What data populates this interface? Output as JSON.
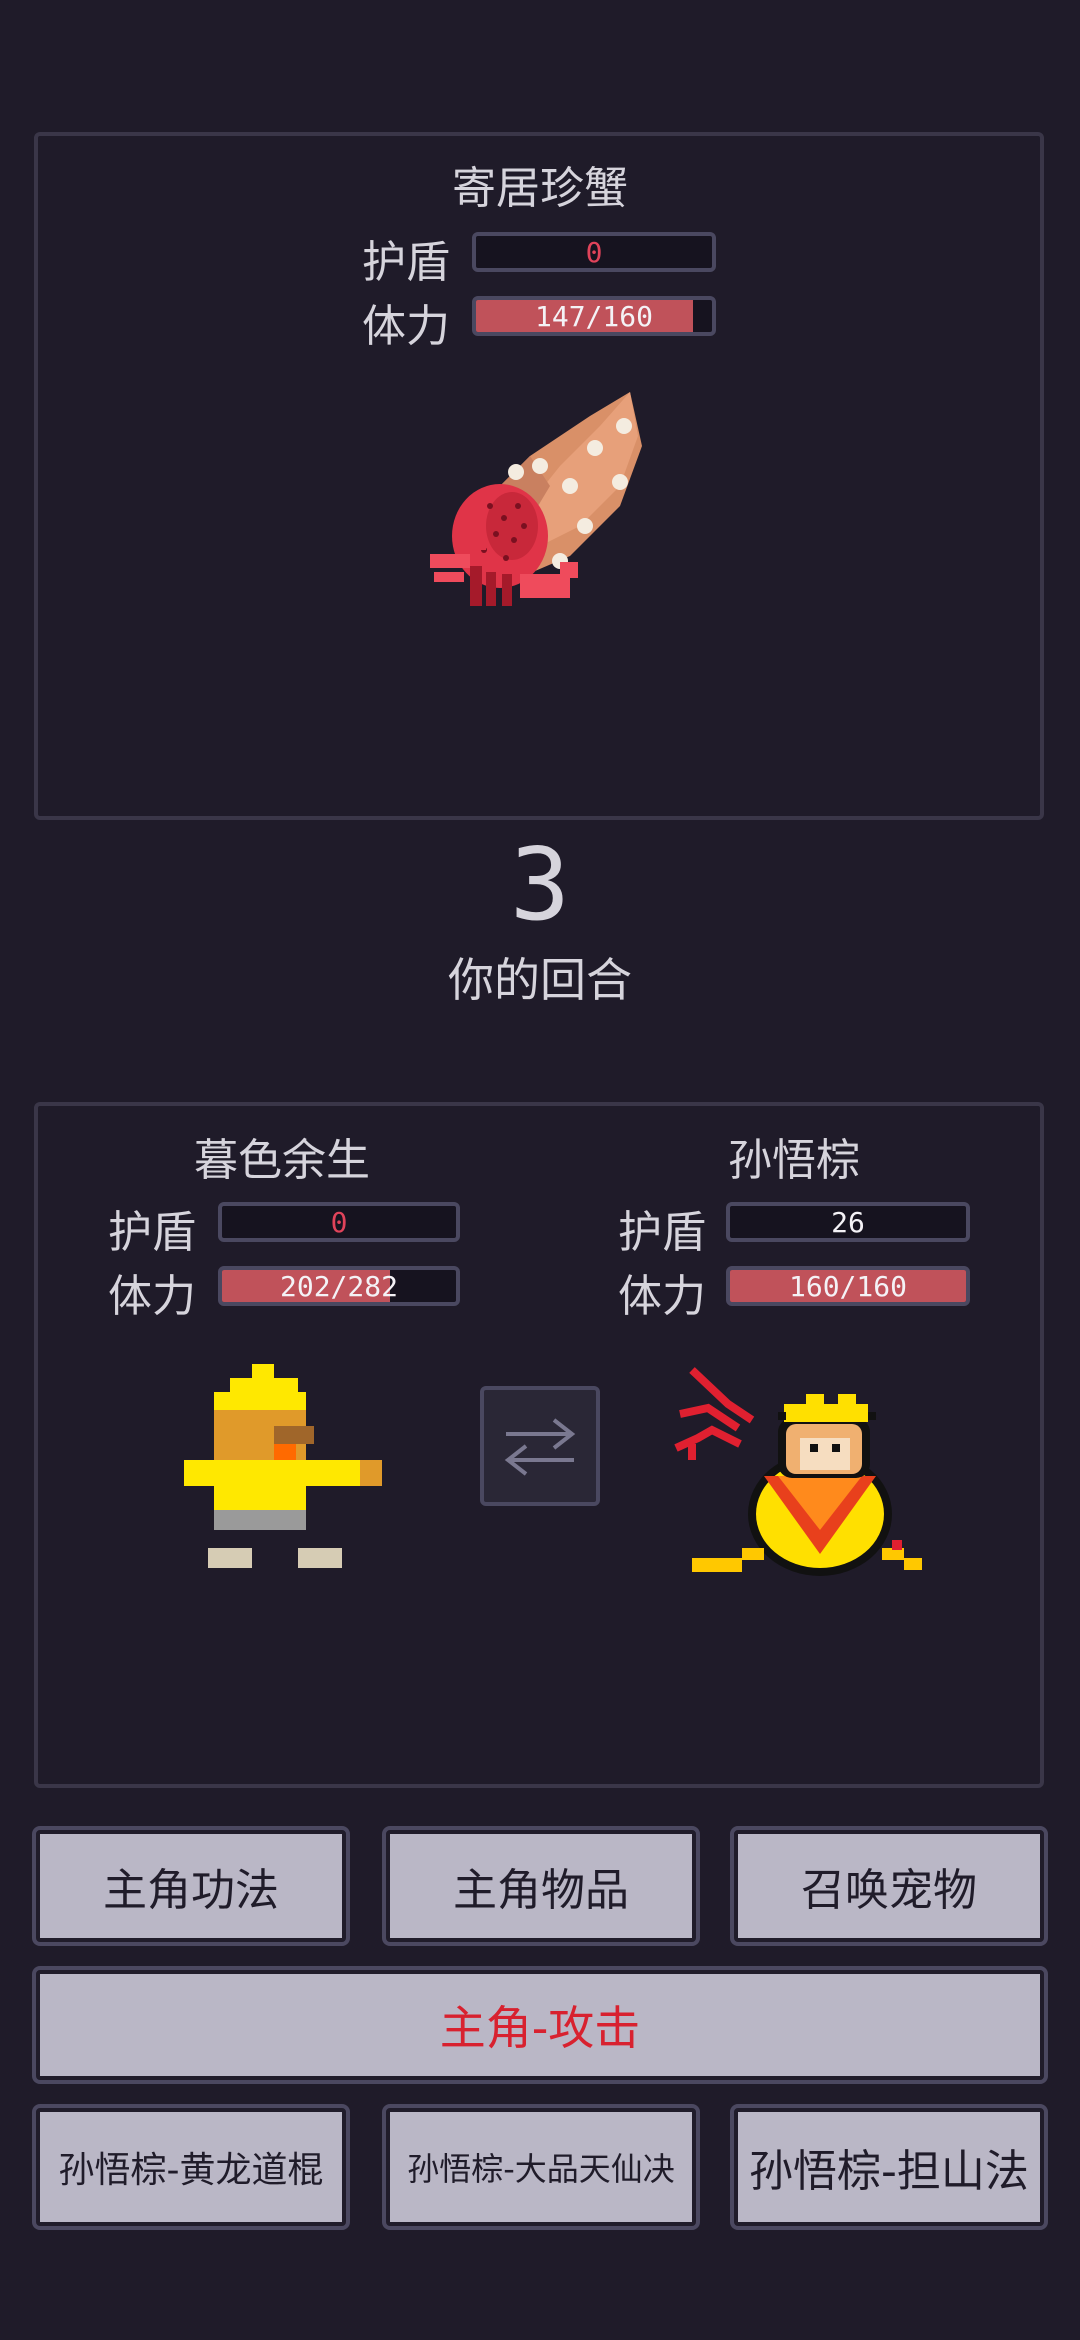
{
  "enemy": {
    "name": "寄居珍蟹",
    "shield_label": "护盾",
    "shield_value": "0",
    "hp_label": "体力",
    "hp_text": "147/160",
    "hp_fraction": 0.919
  },
  "round": {
    "number": "3",
    "turn_text": "你的回合"
  },
  "hero": {
    "name": "暮色余生",
    "shield_label": "护盾",
    "shield_value": "0",
    "hp_label": "体力",
    "hp_text": "202/282",
    "hp_fraction": 0.716
  },
  "pet": {
    "name": "孙悟棕",
    "shield_label": "护盾",
    "shield_value": "26",
    "hp_label": "体力",
    "hp_text": "160/160",
    "hp_fraction": 1.0
  },
  "actions": {
    "hero_skills": "主角功法",
    "hero_items": "主角物品",
    "summon_pet": "召唤宠物",
    "hero_attack": "主角-攻击",
    "pet_skill_1": "孙悟棕-黄龙道棍",
    "pet_skill_2": "孙悟棕-大品天仙决",
    "pet_skill_3": "孙悟棕-担山法"
  },
  "colors": {
    "background": "#1f1b29",
    "hp_fill": "#c0525a",
    "zero_value": "#e0435a",
    "button_bg": "#bab7c6",
    "attack_text": "#d8212f"
  },
  "icons": {
    "swap": "swap-arrows-icon"
  }
}
